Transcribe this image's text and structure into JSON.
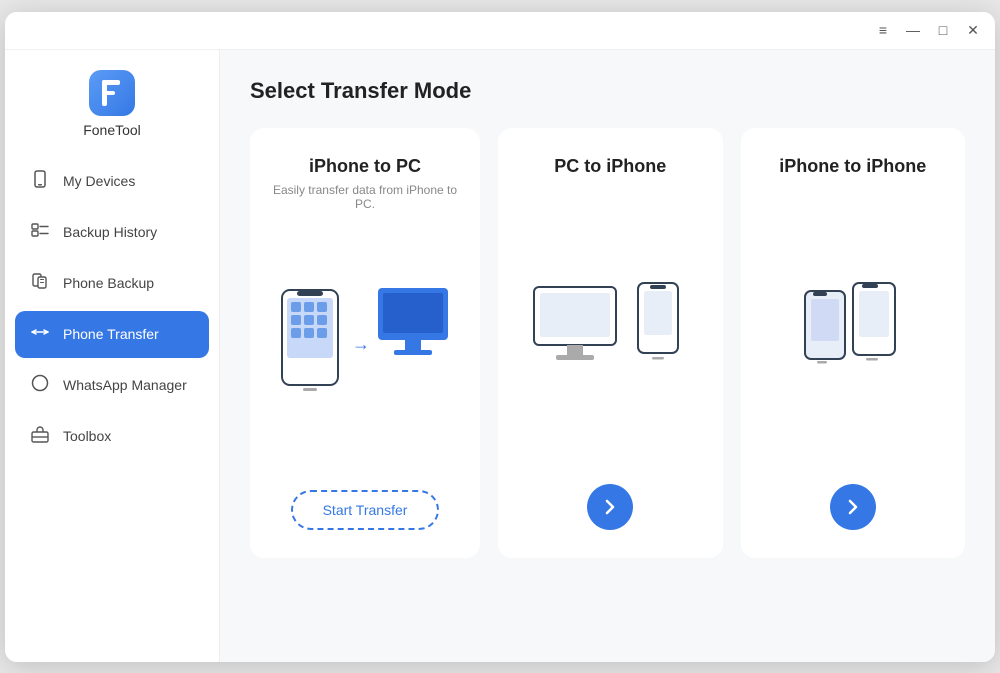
{
  "window": {
    "title": "FoneTool"
  },
  "titlebar": {
    "menu_icon": "≡",
    "minimize_icon": "—",
    "maximize_icon": "□",
    "close_icon": "✕"
  },
  "sidebar": {
    "logo_letter": "F",
    "logo_text": "FoneTool",
    "items": [
      {
        "id": "my-devices",
        "label": "My Devices",
        "icon": "📱",
        "active": false
      },
      {
        "id": "backup-history",
        "label": "Backup History",
        "icon": "☰",
        "active": false
      },
      {
        "id": "phone-backup",
        "label": "Phone Backup",
        "icon": "🖨",
        "active": false
      },
      {
        "id": "phone-transfer",
        "label": "Phone Transfer",
        "icon": "⇄",
        "active": true
      },
      {
        "id": "whatsapp-manager",
        "label": "WhatsApp Manager",
        "icon": "◯",
        "active": false
      },
      {
        "id": "toolbox",
        "label": "Toolbox",
        "icon": "🧰",
        "active": false
      }
    ]
  },
  "main": {
    "page_title": "Select Transfer Mode",
    "cards": [
      {
        "id": "iphone-to-pc",
        "title": "iPhone to PC",
        "desc": "Easily transfer data from iPhone to PC.",
        "action_type": "start-transfer",
        "action_label": "Start Transfer"
      },
      {
        "id": "pc-to-iphone",
        "title": "PC to iPhone",
        "desc": "",
        "action_type": "arrow",
        "action_label": "→"
      },
      {
        "id": "iphone-to-iphone",
        "title": "iPhone to iPhone",
        "desc": "",
        "action_type": "arrow",
        "action_label": "→"
      }
    ]
  }
}
